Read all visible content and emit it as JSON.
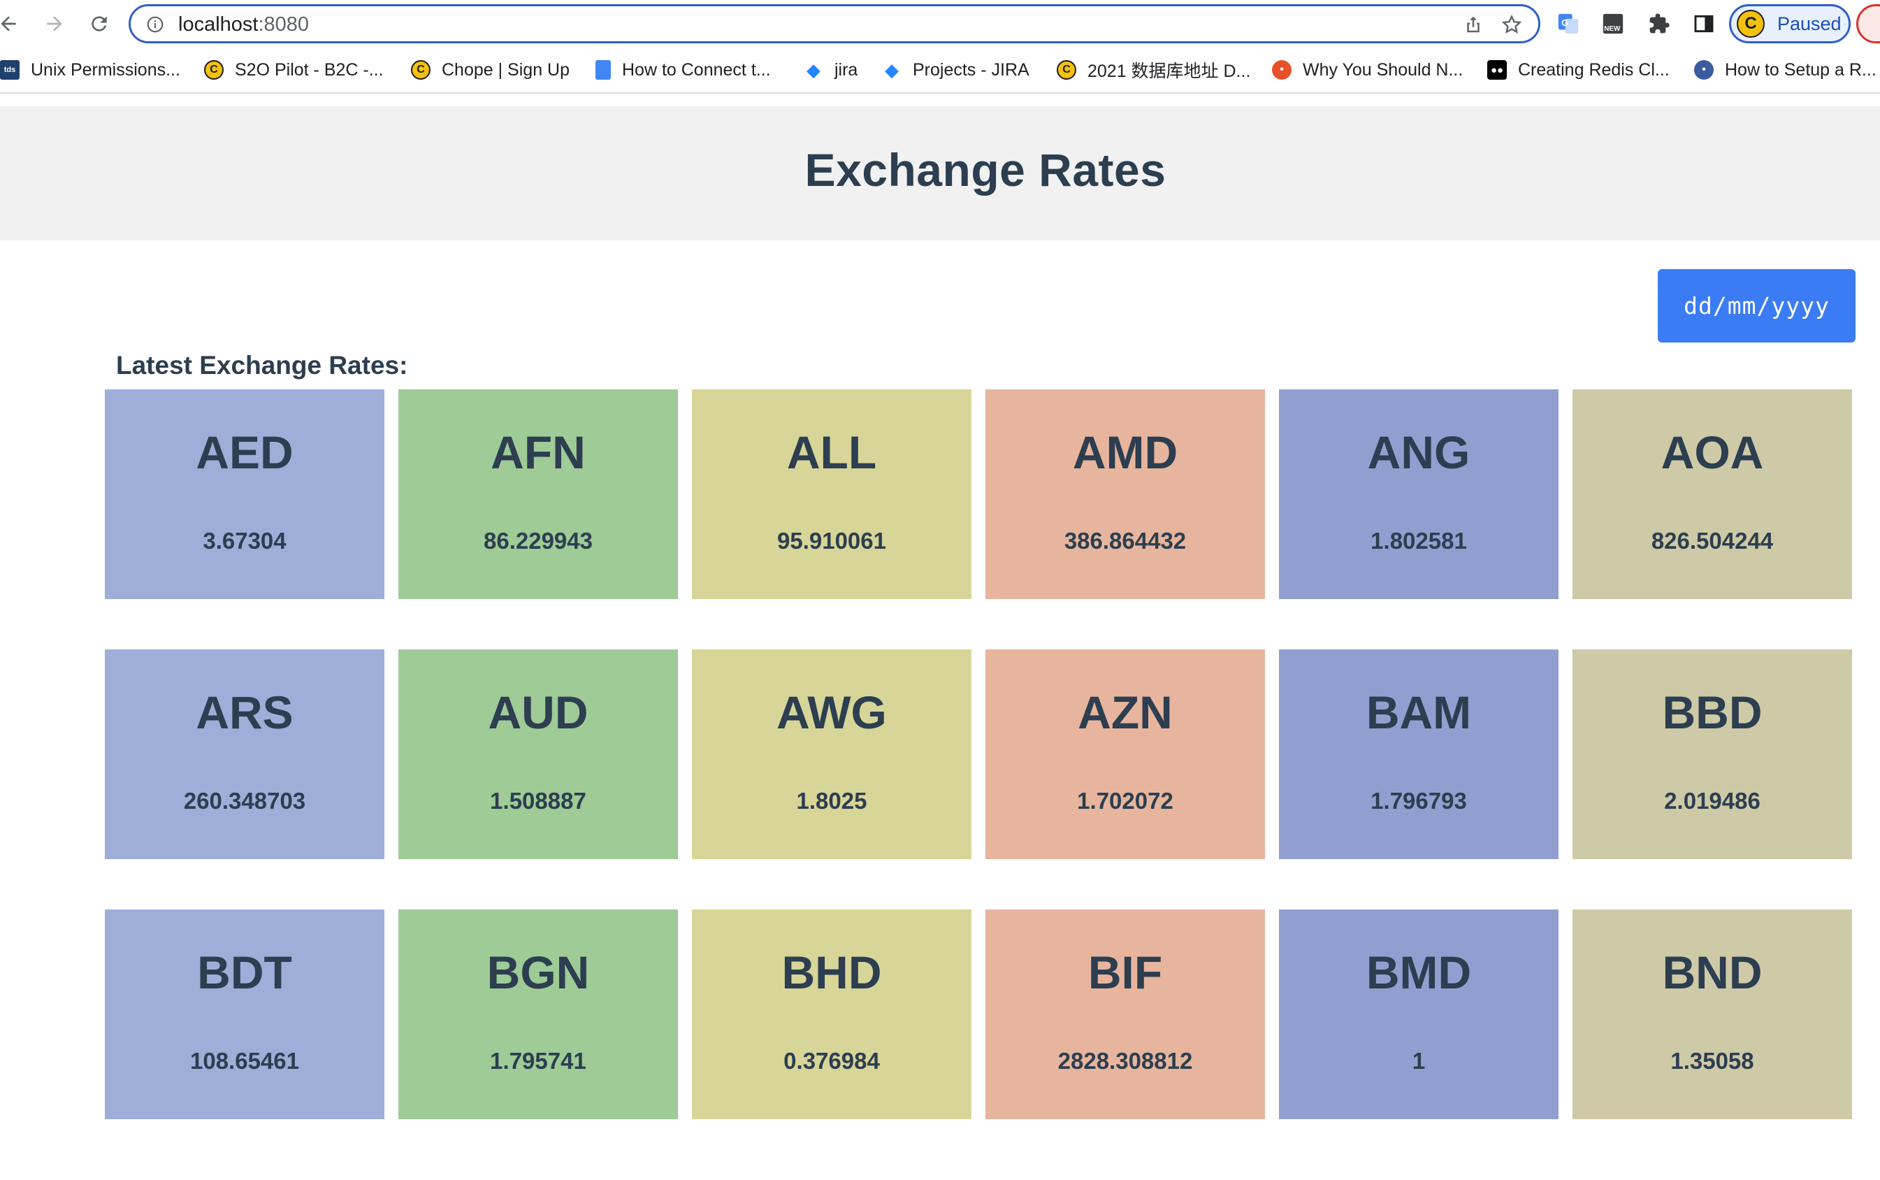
{
  "browser": {
    "url_host": "localhost",
    "url_port": ":8080",
    "profile_label": "Paused",
    "profile_initial": "C",
    "extensions": [
      "google-translate-icon",
      "new-extension-icon",
      "puzzle-icon",
      "side-panel-icon"
    ],
    "ext_new_badge": "NEW"
  },
  "bookmarks": [
    {
      "label": "Unix Permissions...",
      "icon": "tds",
      "color": "#1f3f6e"
    },
    {
      "label": "S2O Pilot - B2C -...",
      "icon": "C",
      "color": "#f4c20d"
    },
    {
      "label": "Chope | Sign Up",
      "icon": "C",
      "color": "#f4c20d"
    },
    {
      "label": "How to Connect t...",
      "icon": "doc",
      "color": "#4285f4"
    },
    {
      "label": "jira",
      "icon": "jira",
      "color": "#2684ff"
    },
    {
      "label": "Projects - JIRA",
      "icon": "jira",
      "color": "#2684ff"
    },
    {
      "label": "2021 数据库地址 D...",
      "icon": "C",
      "color": "#f4c20d"
    },
    {
      "label": "Why You Should N...",
      "icon": "r",
      "color": "#e8502b"
    },
    {
      "label": "Creating Redis Cl...",
      "icon": "M",
      "color": "#000000"
    },
    {
      "label": "How to Setup a R...",
      "icon": "o",
      "color": "#3a5ba0"
    }
  ],
  "page": {
    "title": "Exchange Rates",
    "date_placeholder": "dd/mm/yyyy",
    "section_label": "Latest Exchange Rates:"
  },
  "palette": [
    "#9eaed8",
    "#9ecb96",
    "#d8d598",
    "#e7b59d",
    "#919fd0",
    "#cec9a6"
  ],
  "rates": [
    {
      "code": "AED",
      "rate": "3.67304"
    },
    {
      "code": "AFN",
      "rate": "86.229943"
    },
    {
      "code": "ALL",
      "rate": "95.910061"
    },
    {
      "code": "AMD",
      "rate": "386.864432"
    },
    {
      "code": "ANG",
      "rate": "1.802581"
    },
    {
      "code": "AOA",
      "rate": "826.504244"
    },
    {
      "code": "ARS",
      "rate": "260.348703"
    },
    {
      "code": "AUD",
      "rate": "1.508887"
    },
    {
      "code": "AWG",
      "rate": "1.8025"
    },
    {
      "code": "AZN",
      "rate": "1.702072"
    },
    {
      "code": "BAM",
      "rate": "1.796793"
    },
    {
      "code": "BBD",
      "rate": "2.019486"
    },
    {
      "code": "BDT",
      "rate": "108.65461"
    },
    {
      "code": "BGN",
      "rate": "1.795741"
    },
    {
      "code": "BHD",
      "rate": "0.376984"
    },
    {
      "code": "BIF",
      "rate": "2828.308812"
    },
    {
      "code": "BMD",
      "rate": "1"
    },
    {
      "code": "BND",
      "rate": "1.35058"
    }
  ]
}
